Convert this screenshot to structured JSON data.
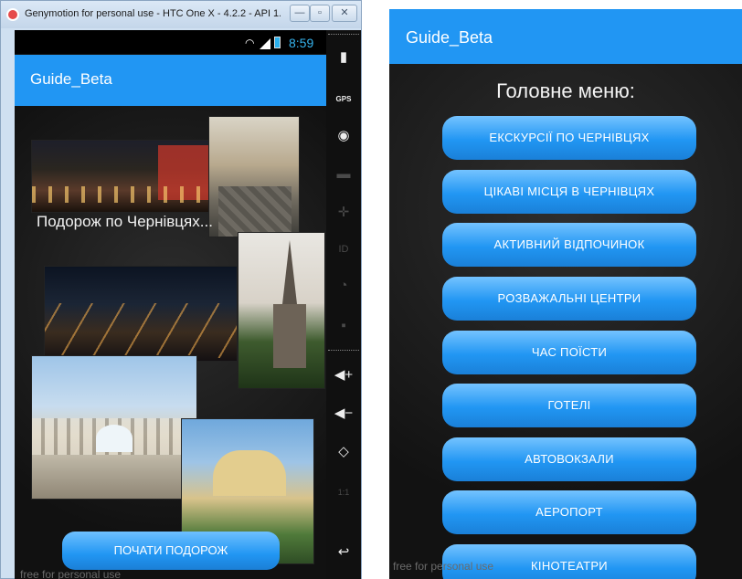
{
  "window": {
    "title": "Genymotion for personal use - HTC One X - 4.2.2 - API 1...",
    "min_symbol": "—",
    "max_symbol": "▫",
    "close_symbol": "✕"
  },
  "status_bar": {
    "time": "8:59"
  },
  "left_screen": {
    "app_title": "Guide_Beta",
    "photo_caption": "Подорож по Чернівцях...",
    "start_button": "ПОЧАТИ ПОДОРОЖ",
    "watermark": "free for personal use"
  },
  "sidebar": {
    "icons": [
      "battery-icon",
      "gps-icon",
      "webcam-icon",
      "clapper-icon",
      "dpad-icon",
      "id-icon",
      "rss-icon",
      "chat-icon",
      "volume-up-icon",
      "volume-down-icon",
      "rotate-icon",
      "scale-icon",
      "back-icon"
    ],
    "gps_label": "GPS",
    "id_label": "ID",
    "scale_label": "1:1"
  },
  "right_screen": {
    "app_title": "Guide_Beta",
    "menu_heading": "Головне меню:",
    "menu_items": [
      "ЕКСКУРСІЇ ПО ЧЕРНІВЦЯХ",
      "ЦІКАВІ МІСЦЯ В ЧЕРНІВЦЯХ",
      "АКТИВНИЙ ВІДПОЧИНОК",
      "РОЗВАЖАЛЬНІ ЦЕНТРИ",
      "ЧАС ПОЇСТИ",
      "ГОТЕЛІ",
      "АВТОВОКЗАЛИ",
      "АЕРОПОРТ",
      "КІНОТЕАТРИ"
    ],
    "watermark": "free for personal use"
  },
  "colors": {
    "accent": "#2196f3",
    "button_top": "#74c3ff",
    "background": "#141414"
  }
}
